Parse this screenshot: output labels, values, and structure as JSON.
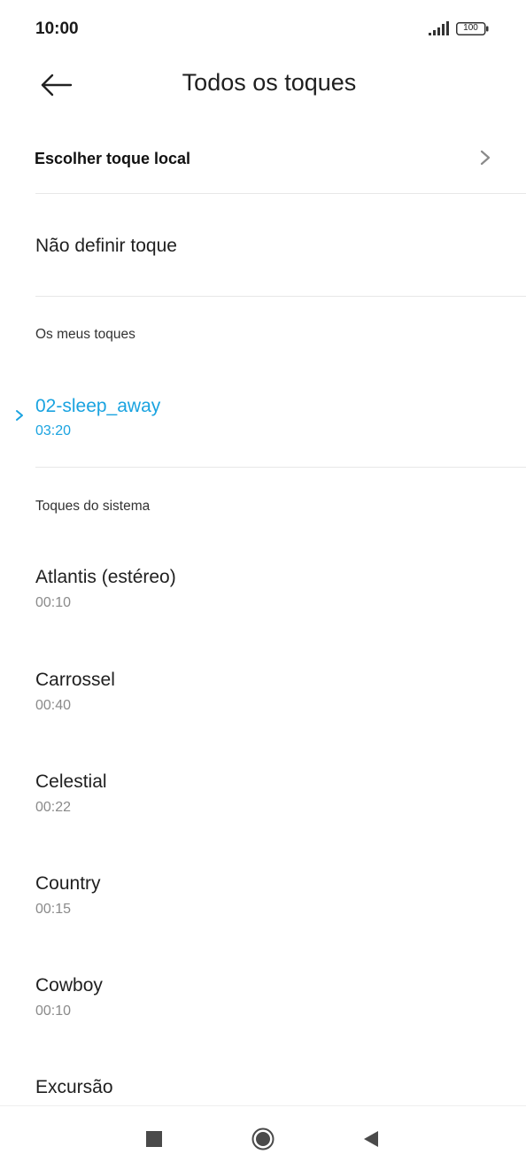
{
  "status_bar": {
    "time": "10:00",
    "battery": "100"
  },
  "header": {
    "title": "Todos os toques"
  },
  "local_tone": {
    "label": "Escolher toque local"
  },
  "no_tone": {
    "label": "Não definir toque"
  },
  "my_tones": {
    "section_title": "Os meus toques",
    "items": [
      {
        "name": "02-sleep_away",
        "duration": "03:20",
        "selected": true
      }
    ]
  },
  "system_tones": {
    "section_title": "Toques do sistema",
    "items": [
      {
        "name": "Atlantis (estéreo)",
        "duration": "00:10"
      },
      {
        "name": "Carrossel",
        "duration": "00:40"
      },
      {
        "name": "Celestial",
        "duration": "00:22"
      },
      {
        "name": "Country",
        "duration": "00:15"
      },
      {
        "name": "Cowboy",
        "duration": "00:10"
      },
      {
        "name": "Excursão",
        "duration": ""
      }
    ]
  },
  "colors": {
    "accent": "#1aa3e0",
    "text": "#1f1f1f",
    "secondary": "#8a8a8a"
  }
}
